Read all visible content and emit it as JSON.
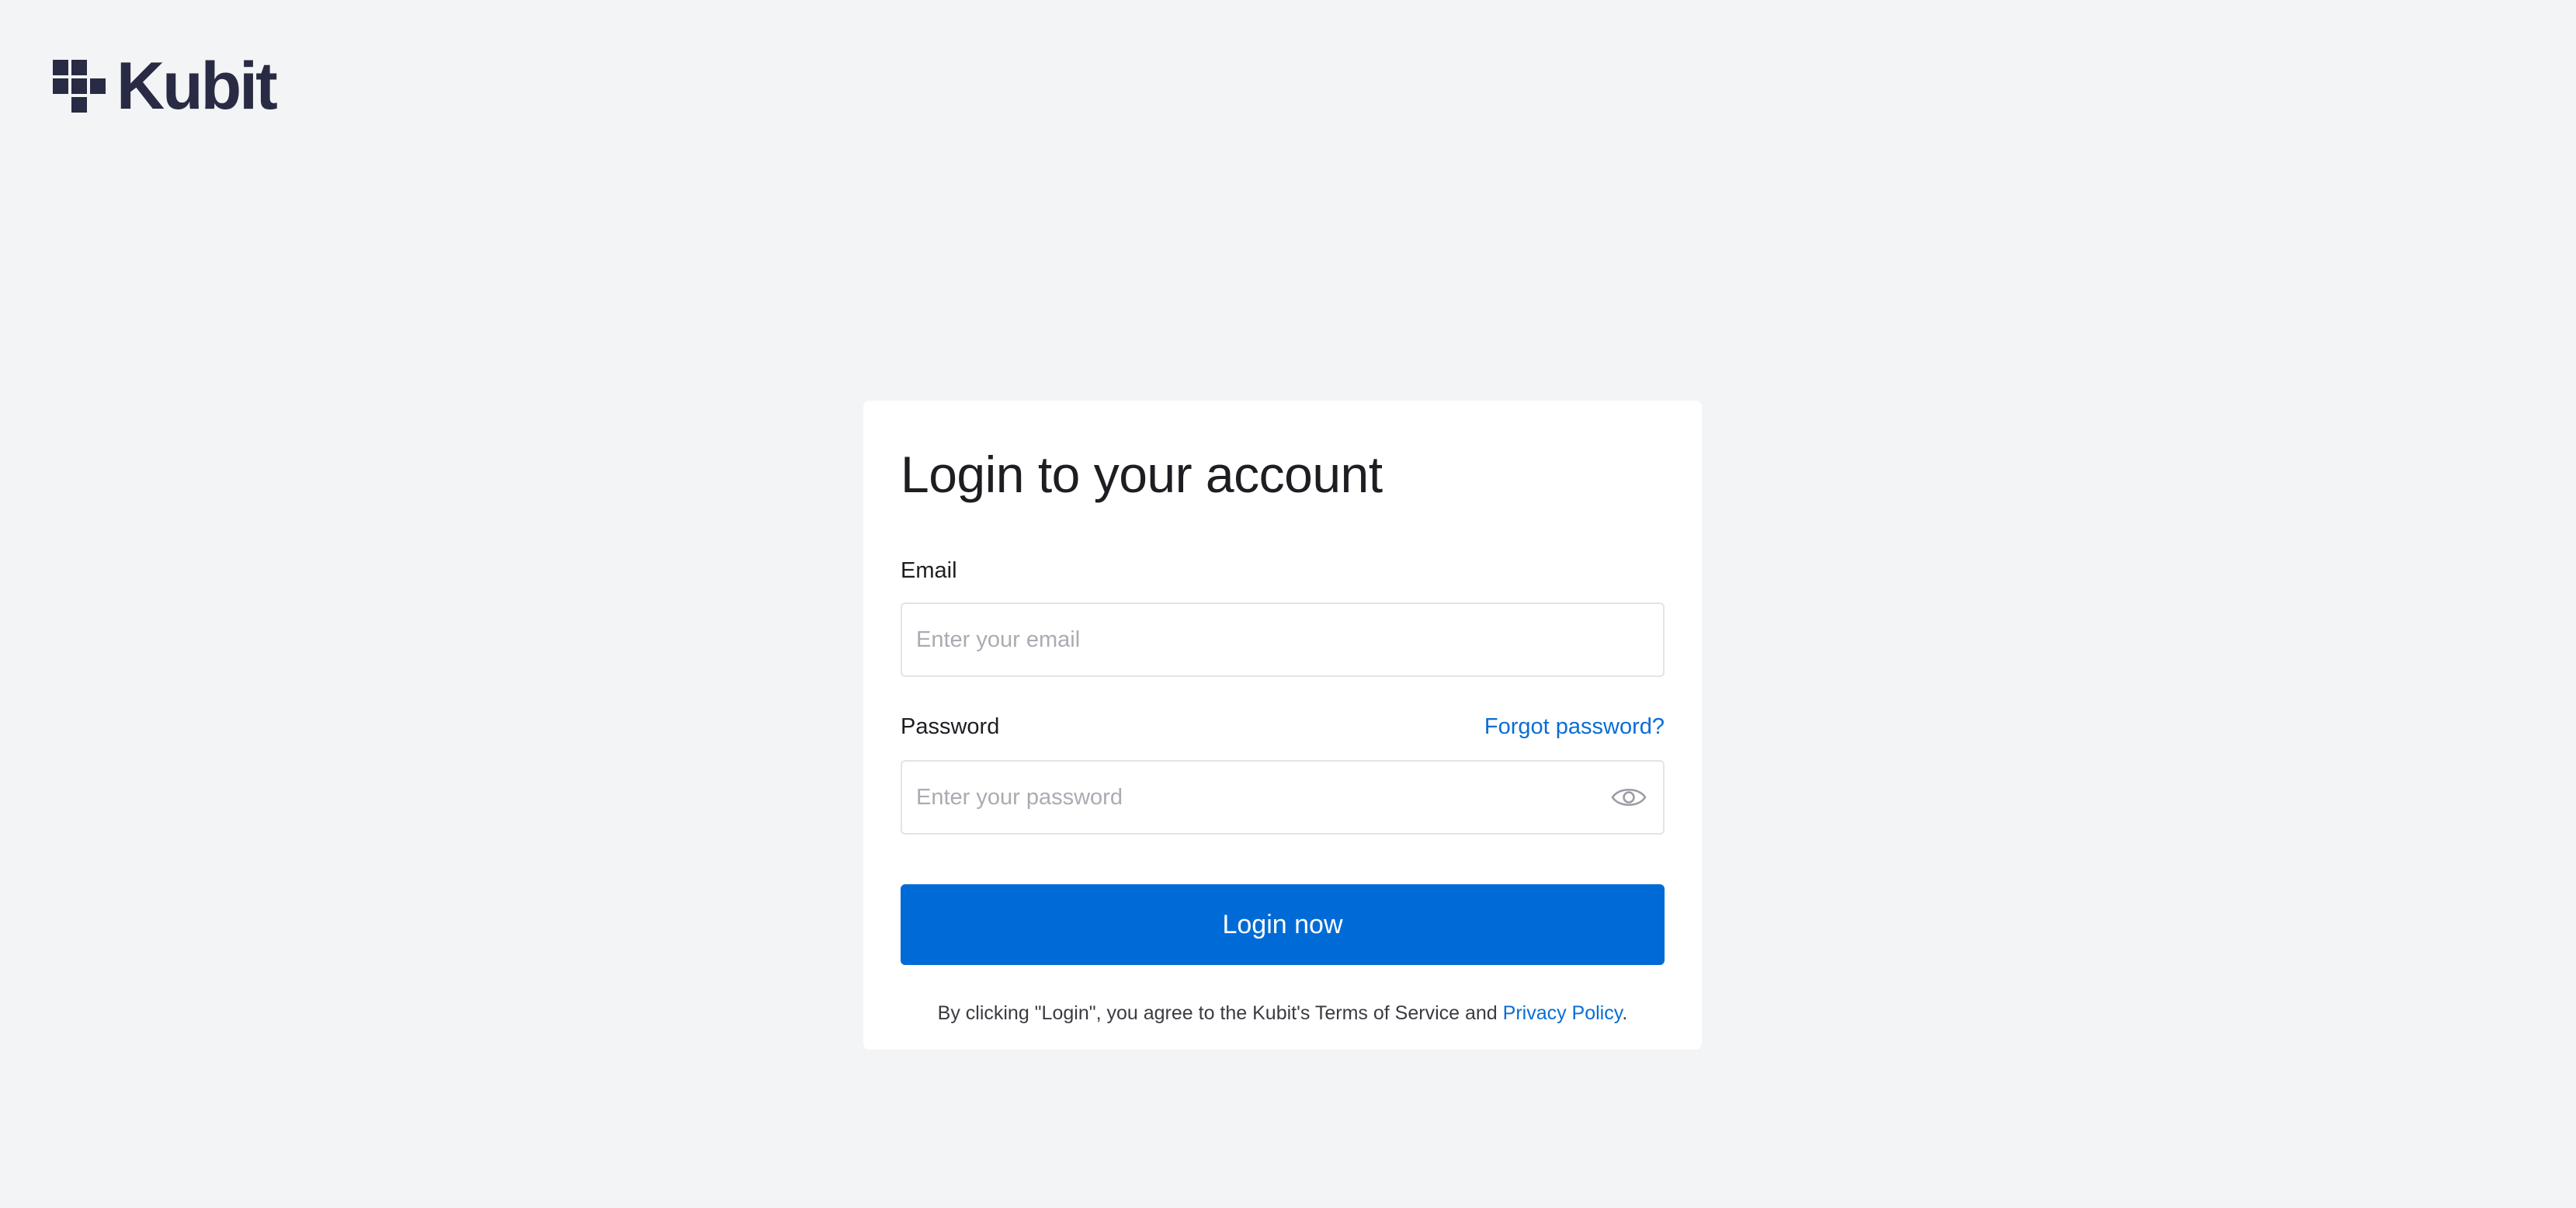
{
  "brand": {
    "name": "Kubit",
    "color": "#292b44"
  },
  "login": {
    "title": "Login to your account",
    "email_label": "Email",
    "email_placeholder": "Enter your email",
    "email_value": "",
    "password_label": "Password",
    "password_placeholder": "Enter your password",
    "password_value": "",
    "forgot_password": "Forgot password?",
    "submit_label": "Login now",
    "terms_text": "By clicking \"Login\", you agree to the Kubit's Terms of Service and",
    "privacy_link": "Privacy Policy",
    "terms_end": "."
  },
  "icons": {
    "logo": "kubit-logo-icon",
    "password_toggle": "eye-icon"
  },
  "colors": {
    "background": "#f3f4f6",
    "card": "#ffffff",
    "primary_button": "#006bd6",
    "link": "#0a6dd6",
    "input_border": "#e2e4e8",
    "placeholder": "#a9acb2"
  }
}
